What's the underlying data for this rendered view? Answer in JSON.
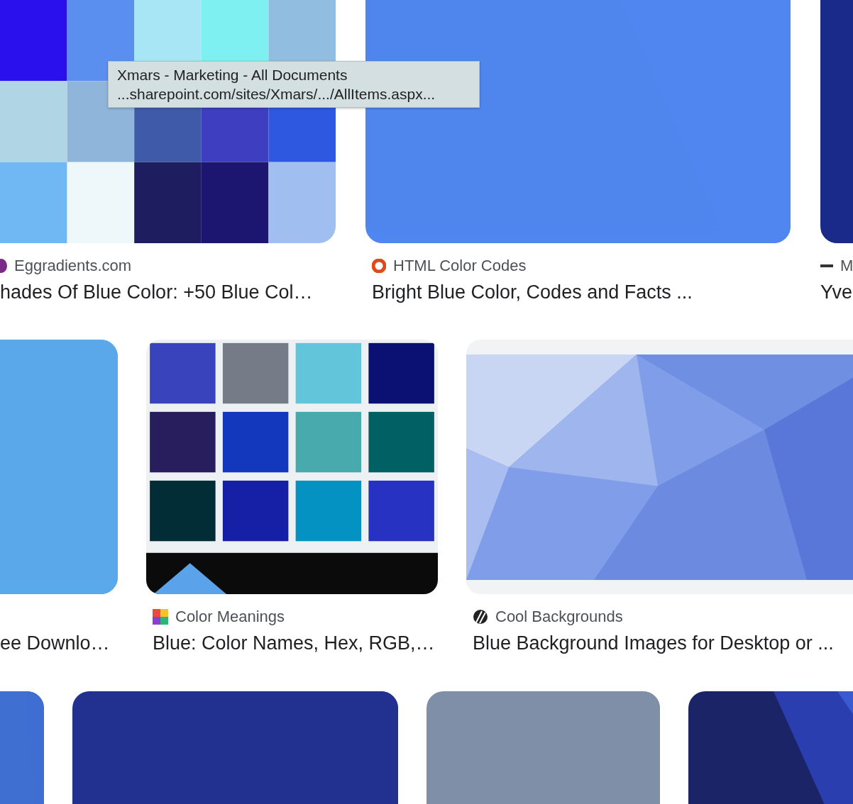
{
  "tooltip": {
    "title": "Xmars - Marketing - All Documents",
    "url": "...sharepoint.com/sites/Xmars/.../AllItems.aspx..."
  },
  "rows": [
    {
      "cards": [
        {
          "kind": "swatch-grid",
          "site": "Eggradients.com",
          "title": "hades Of Blue Color: +50 Blue Col…"
        },
        {
          "kind": "flat",
          "site": "HTML Color Codes",
          "title": "Bright Blue Color, Codes and Facts ..."
        },
        {
          "kind": "flat",
          "site": "M",
          "title": "Yve"
        }
      ]
    },
    {
      "cards": [
        {
          "kind": "flat",
          "title": "ee Downlo…"
        },
        {
          "kind": "swatch-banner",
          "site": "Color Meanings",
          "title": "Blue: Color Names, Hex, RGB,…"
        },
        {
          "kind": "polygons",
          "site": "Cool Backgrounds",
          "title": "Blue Background Images for Desktop or ..."
        }
      ]
    },
    {
      "cards": [
        {
          "kind": "flat"
        },
        {
          "kind": "flat"
        },
        {
          "kind": "flat"
        },
        {
          "kind": "gradient"
        }
      ]
    }
  ]
}
